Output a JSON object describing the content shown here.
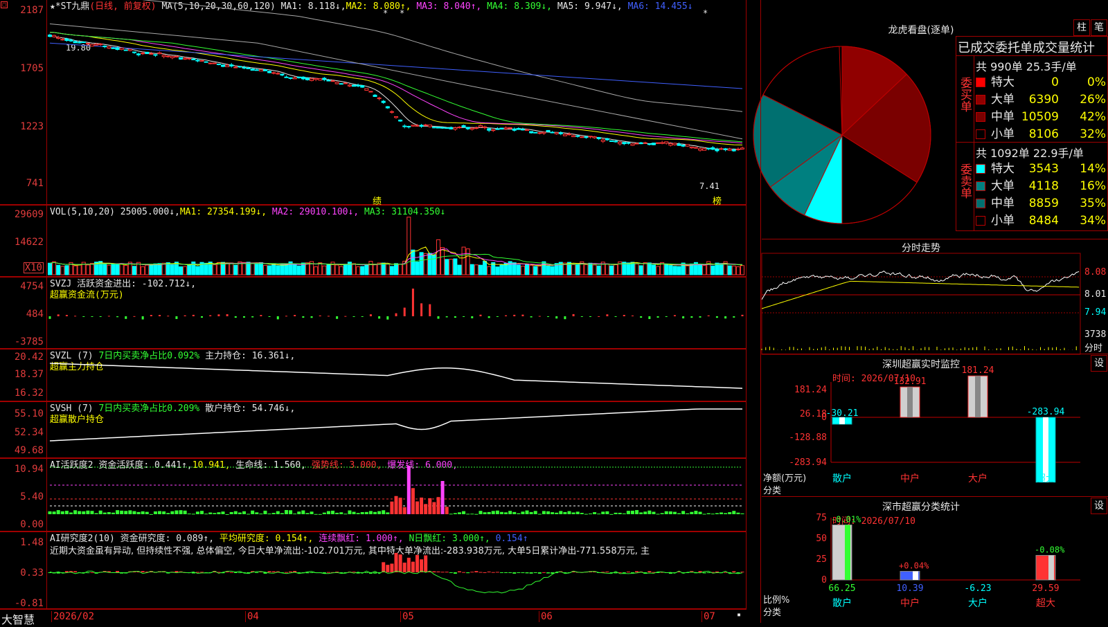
{
  "colors": {
    "up": "#ff3333",
    "down": "#00ffff",
    "ma1": "#e8e8e8",
    "ma2": "#ffff00",
    "ma3": "#ff44ff",
    "ma4": "#33ff33",
    "ma5": "#aaaaaa",
    "ma6": "#4060ff",
    "grid": "#a00000",
    "bg": "#000000"
  },
  "kline": {
    "title_prefix": "★*ST九鼎",
    "period": "(日线, 前复权)",
    "ma_label": "MA(5,10,20,30,60,120)",
    "ma1": "MA1: 8.118↓,",
    "ma2": "MA2: 8.080↑,",
    "ma3": "MA3: 8.040↑,",
    "ma4": "MA4: 8.309↓,",
    "ma5": "MA5: 9.947↓,",
    "ma6": "MA6: 14.455↓",
    "y_labels": [
      "2187",
      "1705",
      "1223",
      "741"
    ],
    "high_mark": "19.80",
    "low_mark": "7.41",
    "marker_ji": "绩",
    "marker_bang": "榜",
    "stars": [
      "*",
      "*",
      "*"
    ]
  },
  "vol": {
    "label": "VOL(5,10,20)",
    "value": "25005.000↓,",
    "ma1": "MA1: 27354.199↓,",
    "ma2": "MA2: 29010.100↓,",
    "ma3": "MA3: 31104.350↓",
    "y_labels": [
      "29609",
      "14622"
    ],
    "unit": "X10"
  },
  "svzj": {
    "label": "SVZJ",
    "desc": "活跃资金进出: -102.712↓,",
    "sub": "超赢资金流(万元)",
    "y_labels": [
      "4754",
      "484",
      "-3785"
    ]
  },
  "svzl": {
    "label": "SVZL (7)",
    "desc1": "7日内买卖净占比0.092%",
    "desc2": "主力持仓: 16.361↓,",
    "sub": "超赢主力持仓",
    "y_labels": [
      "20.42",
      "18.37",
      "16.32"
    ]
  },
  "svsh": {
    "label": "SVSH (7)",
    "desc1": "7日内买卖净占比0.209%",
    "desc2": "散户持仓: 54.746↓,",
    "sub": "超赢散户持仓",
    "y_labels": [
      "55.10",
      "52.34",
      "49.68"
    ]
  },
  "ai1": {
    "label": "AI活跃度2",
    "desc": "资金活跃度: 0.441↑,",
    "v2": "10.941,",
    "life": "生命线: 1.560,",
    "strong": "强势线: 3.000,",
    "burst": "爆发线: 6.000,",
    "y_labels": [
      "10.94",
      "5.40",
      "0.00"
    ]
  },
  "ai2": {
    "label": "AI研究度2(10)",
    "desc": "资金研究度: 0.089↑,",
    "avg": "平均研究度: 0.154↑,",
    "lian": "连续飘红: 1.000↑,",
    "nday": "N日飘红: 3.000↑,",
    "last": "0.154↑",
    "note": "近期大资金虽有异动, 但持续性不强, 总体偏空, 今日大单净流出:-102.701万元, 其中特大单净流出:-283.938万元, 大单5日累计净出-771.558万元, 主",
    "y_labels": [
      "1.48",
      "0.33",
      "-0.81"
    ]
  },
  "xaxis": {
    "labels": [
      "2026/02",
      "04",
      "05",
      "06",
      "07"
    ],
    "brand": "大智慧"
  },
  "lhb": {
    "title": "龙虎看盘(逐单)",
    "btn1": "柱",
    "btn2": "笔",
    "header": "已成交委托单成交量统计",
    "buy_side": "委买单",
    "sell_side": "委卖单",
    "buy_total": "共 990单 25.3手/单",
    "sell_total": "共 1092单 22.9手/单",
    "buy": [
      {
        "name": "特大",
        "vol": "0",
        "pct": "0%",
        "color": "#ff0000",
        "ratio": 0
      },
      {
        "name": "大单",
        "vol": "6390",
        "pct": "26%",
        "color": "#900000",
        "ratio": 0.26
      },
      {
        "name": "中单",
        "vol": "10509",
        "pct": "42%",
        "color": "#7a0000",
        "ratio": 0.42
      },
      {
        "name": "小单",
        "vol": "8106",
        "pct": "32%",
        "color": "#000000",
        "ratio": 0.32
      }
    ],
    "sell": [
      {
        "name": "特大",
        "vol": "3543",
        "pct": "14%",
        "color": "#00ffff",
        "ratio": 0.14
      },
      {
        "name": "大单",
        "vol": "4118",
        "pct": "16%",
        "color": "#008080",
        "ratio": 0.16
      },
      {
        "name": "中单",
        "vol": "8859",
        "pct": "35%",
        "color": "#007070",
        "ratio": 0.35
      },
      {
        "name": "小单",
        "vol": "8484",
        "pct": "34%",
        "color": "#000000",
        "ratio": 0.34
      }
    ]
  },
  "fenshi": {
    "title": "分时走势",
    "y_labels": [
      "8.08",
      "8.01",
      "7.94"
    ],
    "vol_label": "3738",
    "vol_unit": "分时"
  },
  "sz": {
    "title": "深圳超赢实时监控",
    "btn": "设",
    "time": "时间: 2026/07/10",
    "y_labels": [
      "181.24",
      "26.18",
      "0",
      "-128.88",
      "-283.94"
    ],
    "ylabel": "净额(万元)",
    "xlabel": "分类",
    "cats": [
      "散户",
      "中户",
      "大户",
      "超大"
    ],
    "values": [
      -30.21,
      132.91,
      181.24,
      -283.94
    ],
    "value_labels": [
      "-30.21",
      "132.91",
      "181.24",
      "-283.94"
    ]
  },
  "sc": {
    "title": "深市超赢分类统计",
    "btn": "设",
    "time": "时间: 2026/07/10",
    "y_labels": [
      "75",
      "50",
      "25",
      "0"
    ],
    "ylabel": "比例%",
    "xlabel": "分类",
    "cats": [
      "散户",
      "中户",
      "大户",
      "超大"
    ],
    "values": [
      66.25,
      10.39,
      -6.23,
      29.59
    ],
    "value_labels": [
      "66.25",
      "10.39",
      "-6.23",
      "29.59"
    ],
    "top_labels": [
      "-0.01%",
      "+0.04%",
      "",
      "-0.08%"
    ]
  }
}
